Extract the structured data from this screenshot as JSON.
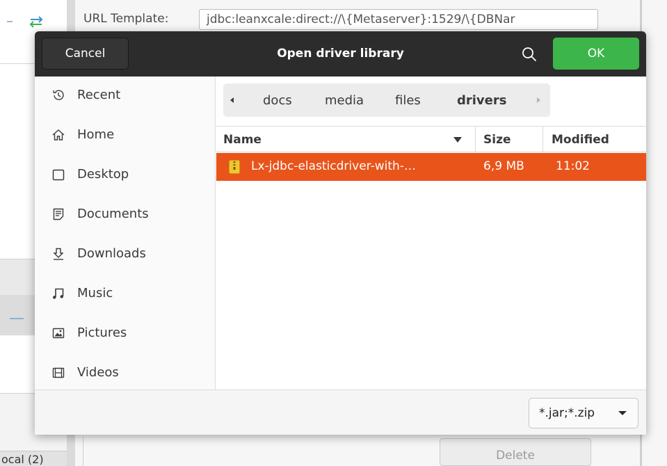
{
  "background": {
    "url_template_label": "URL Template:",
    "url_template_value": "jdbc:leanxcale:direct://\\{Metaserver}:1529/\\{DBNar",
    "delete_label": "Delete",
    "local_label": "ocal (2)"
  },
  "dialog": {
    "cancel_label": "Cancel",
    "title": "Open driver library",
    "ok_label": "OK",
    "ok_color": "#3cb54a",
    "selection_color": "#e9541b"
  },
  "sidebar": {
    "items": [
      {
        "label": "Recent",
        "icon": "clock-icon"
      },
      {
        "label": "Home",
        "icon": "home-icon"
      },
      {
        "label": "Desktop",
        "icon": "desktop-icon"
      },
      {
        "label": "Documents",
        "icon": "documents-icon"
      },
      {
        "label": "Downloads",
        "icon": "downloads-icon"
      },
      {
        "label": "Music",
        "icon": "music-icon"
      },
      {
        "label": "Pictures",
        "icon": "pictures-icon"
      },
      {
        "label": "Videos",
        "icon": "videos-icon"
      }
    ]
  },
  "pathbar": {
    "segments": [
      "docs",
      "media",
      "files",
      "drivers"
    ],
    "current": "drivers"
  },
  "filelist": {
    "columns": {
      "name": "Name",
      "size": "Size",
      "modified": "Modified"
    },
    "rows": [
      {
        "name": "Lx-jdbc-elasticdriver-with-…",
        "size": "6,9 MB",
        "modified": "11:02",
        "selected": true
      }
    ]
  },
  "footer": {
    "filter_value": "*.jar;*.zip"
  }
}
